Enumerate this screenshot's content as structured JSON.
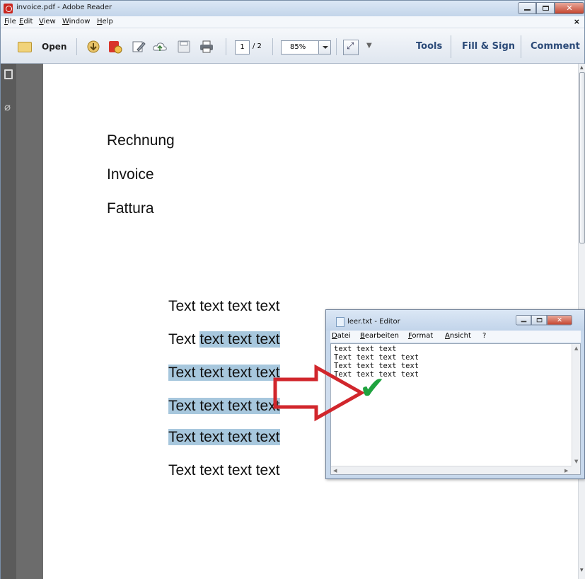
{
  "window": {
    "title": "invoice.pdf - Adobe Reader"
  },
  "menubar": {
    "items": [
      "File",
      "Edit",
      "View",
      "Window",
      "Help"
    ],
    "close_doc": "×"
  },
  "toolbar": {
    "open_label": "Open",
    "page_current": "1",
    "page_total": "/ 2",
    "zoom": "85%",
    "more": "▼",
    "tools_label": "Tools",
    "fill_sign_label": "Fill & Sign",
    "comment_label": "Comment"
  },
  "document": {
    "headings": [
      "Rechnung",
      "Invoice",
      "Fattura"
    ],
    "lines": [
      {
        "plain": "Text text text text",
        "selected": ""
      },
      {
        "plain": "Text ",
        "selected": "text text text"
      },
      {
        "plain": "",
        "selected": "Text text text text"
      },
      {
        "plain": "",
        "selected": "Text text text text"
      },
      {
        "plain": "",
        "selected": "Text text text text"
      },
      {
        "plain": "Text text text text",
        "selected": ""
      }
    ]
  },
  "notepad": {
    "title": "leer.txt - Editor",
    "menu": [
      "Datei",
      "Bearbeiten",
      "Format",
      "Ansicht",
      "?"
    ],
    "lines": [
      "text text text",
      "Text text text text",
      "Text text text text",
      "Text text text text"
    ]
  },
  "annotation": {
    "arrow_color": "#d1262c",
    "check_color": "#1fa33f",
    "check_glyph": "✔"
  },
  "colors": {
    "selection": "#a7c7dd",
    "chrome": "#cbdcef",
    "pane_label": "#2b4a78"
  }
}
